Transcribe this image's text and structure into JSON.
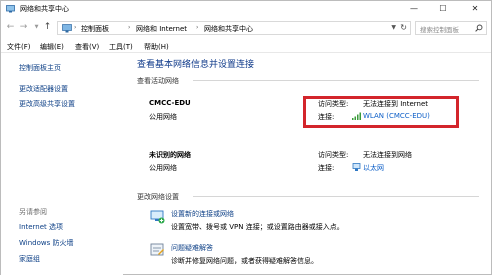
{
  "window": {
    "title": "网络和共享中心",
    "minimize": "—",
    "maximize": "☐",
    "close": "✕"
  },
  "address": {
    "breadcrumbs": [
      "控制面板",
      "网络和 Internet",
      "网络和共享中心"
    ],
    "separator": "›",
    "search_placeholder": "搜索控制面板"
  },
  "menu": [
    "文件(F)",
    "编辑(E)",
    "查看(V)",
    "工具(T)",
    "帮助(H)"
  ],
  "left": {
    "links": [
      "控制面板主页",
      "更改适配器设置",
      "更改高级共享设置"
    ],
    "see_also_title": "另请参阅",
    "see_also": [
      "Internet 选项",
      "Windows 防火墙",
      "家庭组"
    ]
  },
  "main": {
    "title": "查看基本网络信息并设置连接",
    "active_heading": "查看活动网络",
    "networks": [
      {
        "name": "CMCC-EDU",
        "type": "公用网络",
        "access_label": "访问类型:",
        "access_value": "无法连接到 Internet",
        "conn_label": "连接:",
        "conn_value": "WLAN (CMCC-EDU)"
      },
      {
        "name": "未识别的网络",
        "type": "公用网络",
        "access_label": "访问类型:",
        "access_value": "无法连接到网络",
        "conn_label": "连接:",
        "conn_value": "以太网"
      }
    ],
    "change_heading": "更改网络设置",
    "tasks": [
      {
        "link": "设置新的连接或网络",
        "desc": "设置宽带、拨号或 VPN 连接；或设置路由器或接入点。"
      },
      {
        "link": "问题疑难解答",
        "desc": "诊断并修复网络问题，或者获得疑难解答信息。"
      }
    ]
  },
  "colors": {
    "highlight": "#d3252b",
    "link": "#0c3f86",
    "title_blue": "#0f3a8a"
  }
}
